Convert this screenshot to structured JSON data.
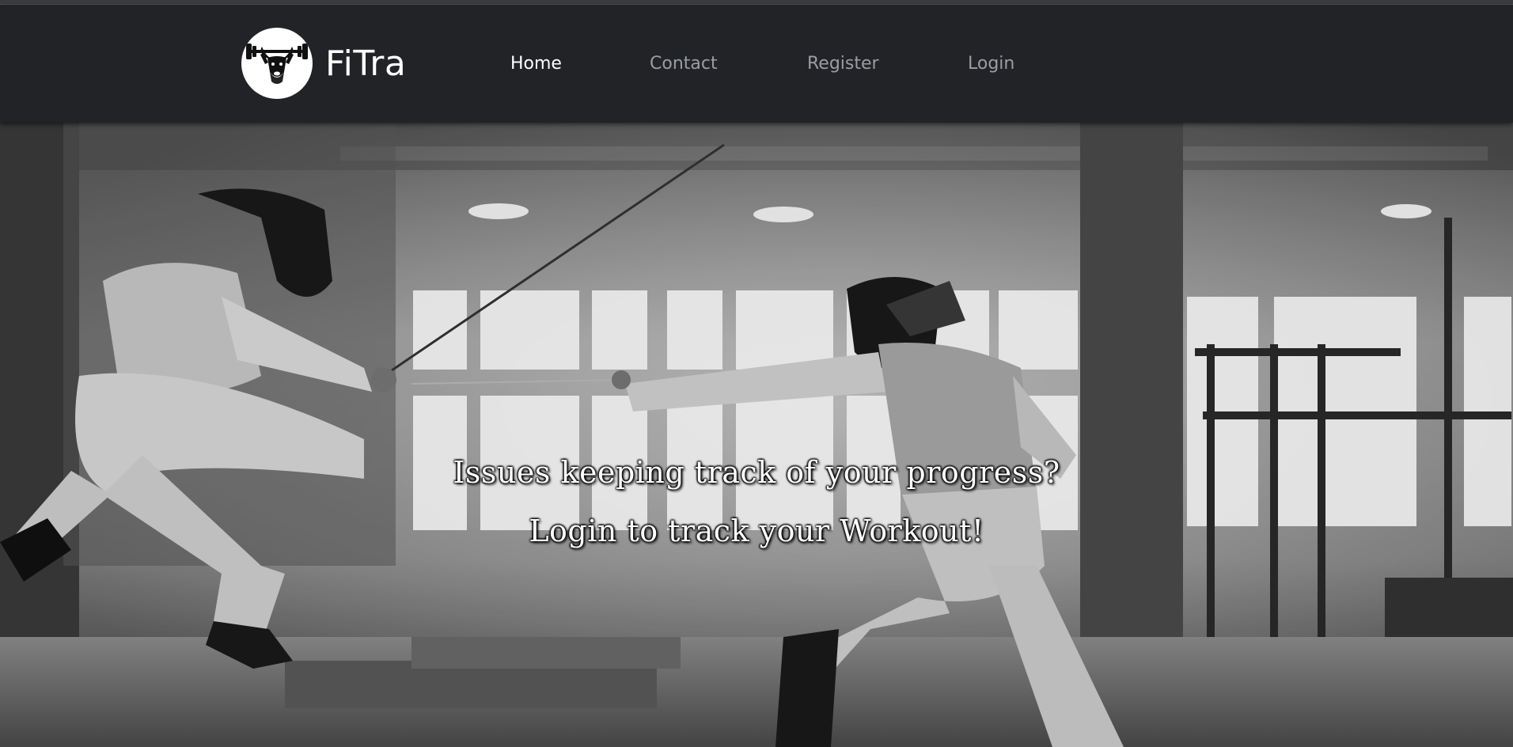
{
  "brand": {
    "name": "FiTra",
    "logo_icon": "bull-deadlift-logo-icon"
  },
  "nav": {
    "items": [
      {
        "label": "Home",
        "active": true
      },
      {
        "label": "Contact",
        "active": false
      },
      {
        "label": "Register",
        "active": false
      },
      {
        "label": "Login",
        "active": false
      }
    ]
  },
  "hero": {
    "line1": "Issues keeping track of your progress?",
    "line2": "Login to track your Workout!",
    "image_icon": "fencing-gym-photo"
  },
  "colors": {
    "navbar_bg": "#212327",
    "nav_active": "#ffffff",
    "nav_inactive": "#9a9da2"
  }
}
